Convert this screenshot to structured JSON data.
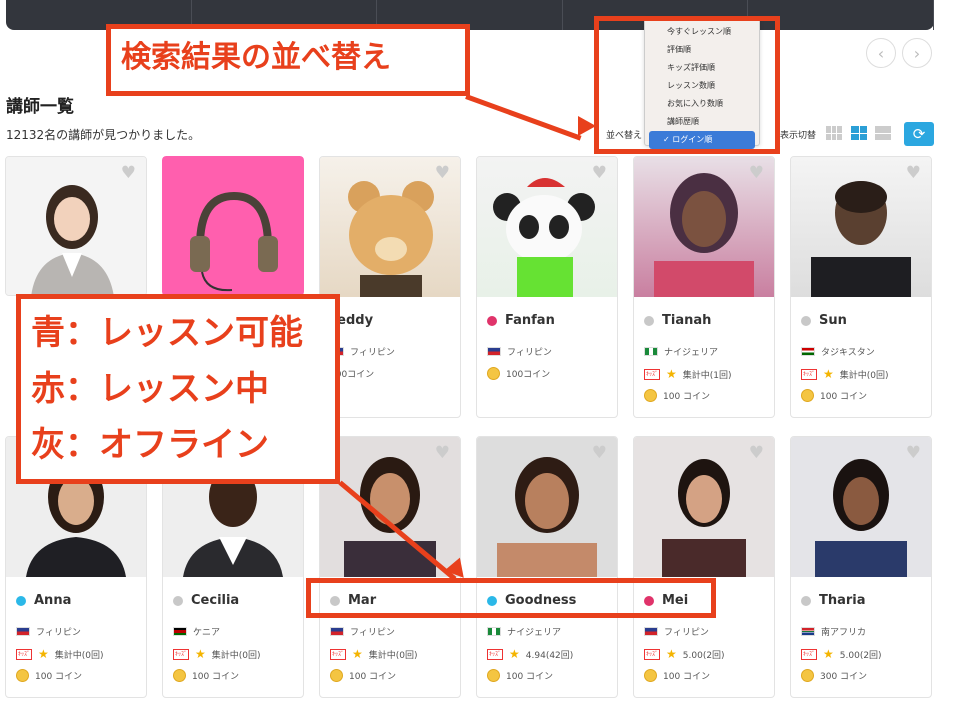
{
  "page": {
    "title": "講師一覧",
    "count_text": "12132名の講師が見つかりました。",
    "sort_label": "並べ替え",
    "view_label": "表示切替"
  },
  "nav": {
    "prev": "‹",
    "next": "›"
  },
  "sort_options": [
    "今すぐレッスン順",
    "評価順",
    "キッズ評価順",
    "レッスン数順",
    "お気に入り数順",
    "講師歴順",
    "ログイン順"
  ],
  "sort_selected": "ログイン順",
  "annotations": {
    "sort_title": "検索結果の並べ替え",
    "legend_blue": "青：レッスン可能",
    "legend_red": "赤：レッスン中",
    "legend_gray": "灰：オフライン"
  },
  "status_colors": {
    "available": "#2bb8e8",
    "in_lesson": "#e0336a",
    "offline": "#c8c8c8"
  },
  "row1": [
    {
      "name": "",
      "country": "",
      "price": ""
    },
    {
      "name": "",
      "country": "",
      "price": ""
    },
    {
      "name": "Teddy",
      "status": "offline",
      "country": "フィリピン",
      "price": "100コイン",
      "rating": ""
    },
    {
      "name": "Fanfan",
      "status": "in_lesson",
      "country": "フィリピン",
      "price": "100コイン",
      "rating": ""
    },
    {
      "name": "Tianah",
      "status": "offline",
      "country": "ナイジェリア",
      "price": "100 コイン",
      "rating": "集計中(1回)"
    },
    {
      "name": "Sun",
      "status": "offline",
      "country": "タジキスタン",
      "price": "100 コイン",
      "rating": "集計中(0回)"
    }
  ],
  "row2": [
    {
      "name": "Anna",
      "status": "available",
      "country": "フィリピン",
      "price": "100 コイン",
      "rating": "集計中(0回)"
    },
    {
      "name": "Cecilia",
      "status": "offline",
      "country": "ケニア",
      "price": "100 コイン",
      "rating": "集計中(0回)"
    },
    {
      "name": "Mar",
      "status": "offline",
      "country": "フィリピン",
      "price": "100 コイン",
      "rating": "集計中(0回)"
    },
    {
      "name": "Goodness",
      "status": "available",
      "country": "ナイジェリア",
      "price": "100 コイン",
      "rating": "4.94(42回)"
    },
    {
      "name": "Mei",
      "status": "in_lesson",
      "country": "フィリピン",
      "price": "100 コイン",
      "rating": "5.00(2回)"
    },
    {
      "name": "Tharia",
      "status": "offline",
      "country": "南アフリカ",
      "price": "300 コイン",
      "rating": "5.00(2回)"
    }
  ]
}
